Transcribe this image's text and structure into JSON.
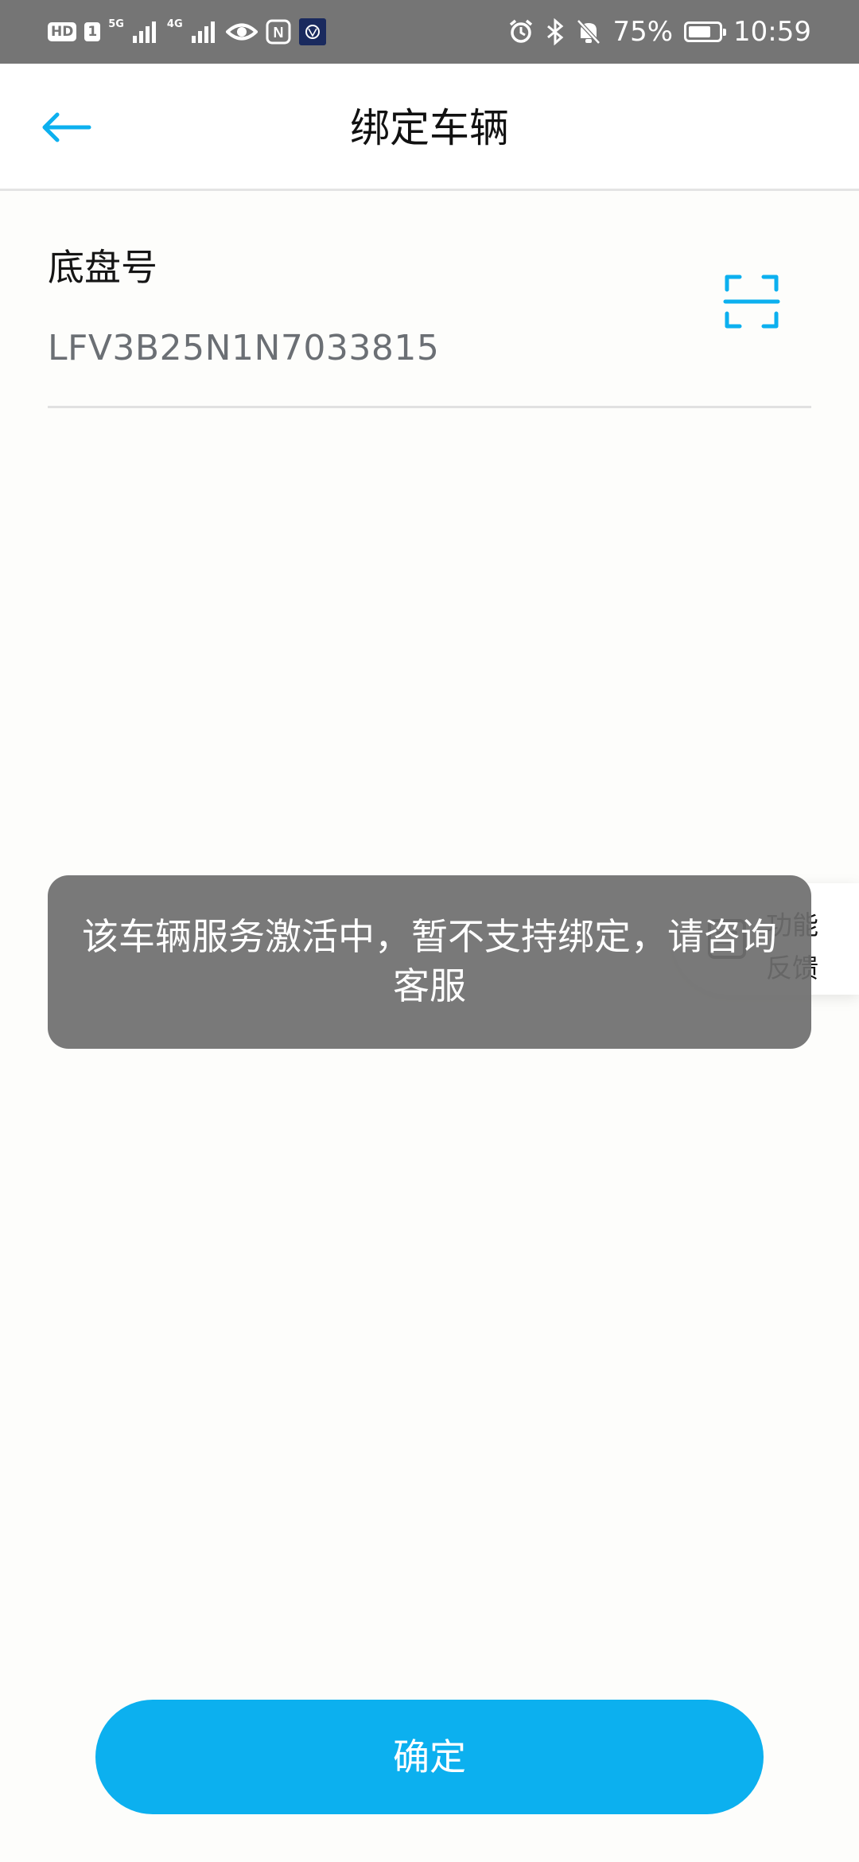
{
  "status_bar": {
    "hd_label": "HD",
    "sim_number": "1",
    "net1_label": "5G",
    "net2_label": "4G",
    "nfc_label": "N",
    "battery_percent": "75%",
    "battery_level": 0.75,
    "time": "10:59"
  },
  "header": {
    "title": "绑定车辆",
    "back_icon": "arrow-left-icon"
  },
  "form": {
    "vin_label": "底盘号",
    "vin_value": "LFV3B25N1N7033815",
    "scan_icon": "scan-icon"
  },
  "feedback": {
    "line1": "功能",
    "line2": "反馈",
    "icon": "feedback-icon"
  },
  "toast": {
    "message": "该车辆服务激活中，暂不支持绑定，请咨询客服"
  },
  "confirm": {
    "label": "确定"
  },
  "colors": {
    "accent": "#0cb0ef",
    "status_bar": "#757575",
    "toast_bg": "#6e6e6e"
  }
}
